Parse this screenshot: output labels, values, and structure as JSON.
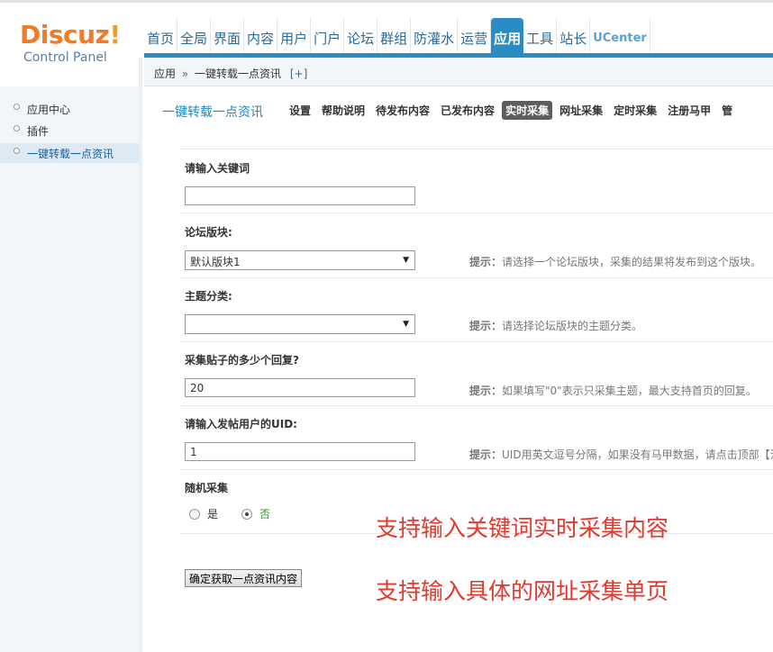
{
  "logo": {
    "word": "Discuz",
    "exclaim": "!",
    "sub": "Control Panel"
  },
  "nav": [
    {
      "label": "首页"
    },
    {
      "label": "全局"
    },
    {
      "label": "界面"
    },
    {
      "label": "内容"
    },
    {
      "label": "用户"
    },
    {
      "label": "门户"
    },
    {
      "label": "论坛"
    },
    {
      "label": "群组"
    },
    {
      "label": "防灌水"
    },
    {
      "label": "运营"
    },
    {
      "label": "应用",
      "active": true
    },
    {
      "label": "工具"
    },
    {
      "label": "站长"
    },
    {
      "label": "UCenter"
    }
  ],
  "breadcrumb": {
    "part1": "应用",
    "sep": "»",
    "part2": "一键转载一点资讯",
    "add": "[+]"
  },
  "sidebar": {
    "items": [
      {
        "label": "应用中心"
      },
      {
        "label": "插件"
      },
      {
        "label": "一键转载一点资讯",
        "active": true
      }
    ]
  },
  "plugin": {
    "title": "一键转载一点资讯",
    "tabs": [
      "设置",
      "帮助说明",
      "待发布内容",
      "已发布内容",
      "实时采集",
      "网址采集",
      "定时采集",
      "注册马甲",
      "管"
    ],
    "active_tab": "实时采集"
  },
  "form": {
    "keyword": {
      "label": "请输入关键词",
      "value": ""
    },
    "forum": {
      "label": "论坛版块:",
      "value": "默认版块1",
      "hint_prefix": "提示：",
      "hint": "请选择一个论坛版块，采集的结果将发布到这个版块。"
    },
    "category": {
      "label": "主题分类:",
      "value": "",
      "hint_prefix": "提示：",
      "hint": "请选择论坛版块的主题分类。"
    },
    "replies": {
      "label": "采集贴子的多少个回复?",
      "value": "20",
      "hint_prefix": "提示：",
      "hint": "如果填写\"0\"表示只采集主题，最大支持首页的回复。"
    },
    "uid": {
      "label": "请输入发帖用户的UID:",
      "value": "1",
      "hint_prefix": "提示：",
      "hint": "UID用英文逗号分隔，如果没有马甲数据，请点击顶部【注"
    },
    "random": {
      "label": "随机采集",
      "yes": "是",
      "no": "否",
      "selected": "否"
    },
    "submit": "确定获取一点资讯内容"
  },
  "overlay": {
    "line1": "支持输入关键词实时采集内容",
    "line2": "支持输入具体的网址采集单页"
  },
  "colors": {
    "accent": "#2b8cc4",
    "logo": "#f17b26",
    "overlay": "#e03a2f"
  }
}
